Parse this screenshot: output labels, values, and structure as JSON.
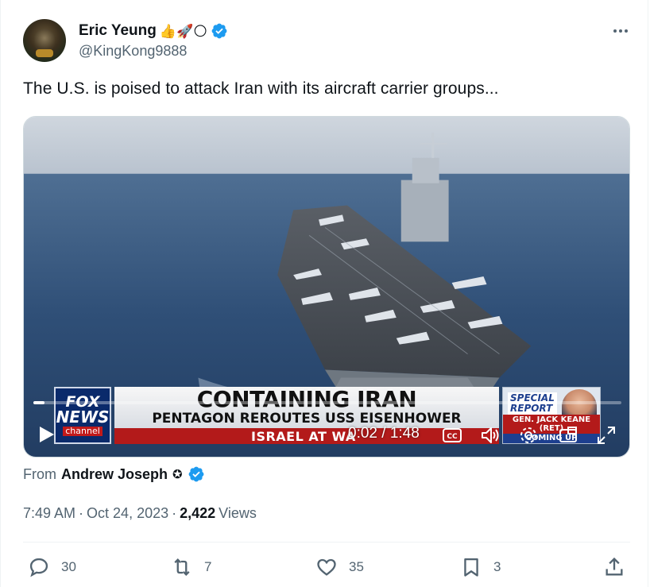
{
  "author": {
    "display_name": "Eric Yeung",
    "emojis": "👍🚀🌕",
    "handle": "@KingKong9888"
  },
  "tweet": {
    "text": "The U.S. is poised to attack Iran with its aircraft carrier groups..."
  },
  "video": {
    "headline": "CONTAINING IRAN",
    "subheadline": "PENTAGON REROUTES USS EISENHOWER",
    "ticker": "ISRAEL AT WA",
    "network_logo_top": "FOX",
    "network_logo_mid": "NEWS",
    "network_logo_bottom": "channel",
    "special_label_1": "SPECIAL",
    "special_label_2": "REPORT",
    "guest_name": "GEN. JACK KEANE (RET)",
    "guest_sub": "COMING UP",
    "time_display": "0:02 / 1:48",
    "progress_fraction": 0.019
  },
  "source": {
    "prefix": "From",
    "name": "Andrew Joseph",
    "mark": "✪"
  },
  "meta": {
    "time": "7:49 AM",
    "separator": "·",
    "date": "Oct 24, 2023",
    "views_count": "2,422",
    "views_label": "Views"
  },
  "actions": {
    "replies": "30",
    "reposts": "7",
    "likes": "35",
    "bookmarks": "3"
  },
  "colors": {
    "verified": "#1d9bf0",
    "secondary_text": "#536471",
    "primary_text": "#0f1419"
  }
}
